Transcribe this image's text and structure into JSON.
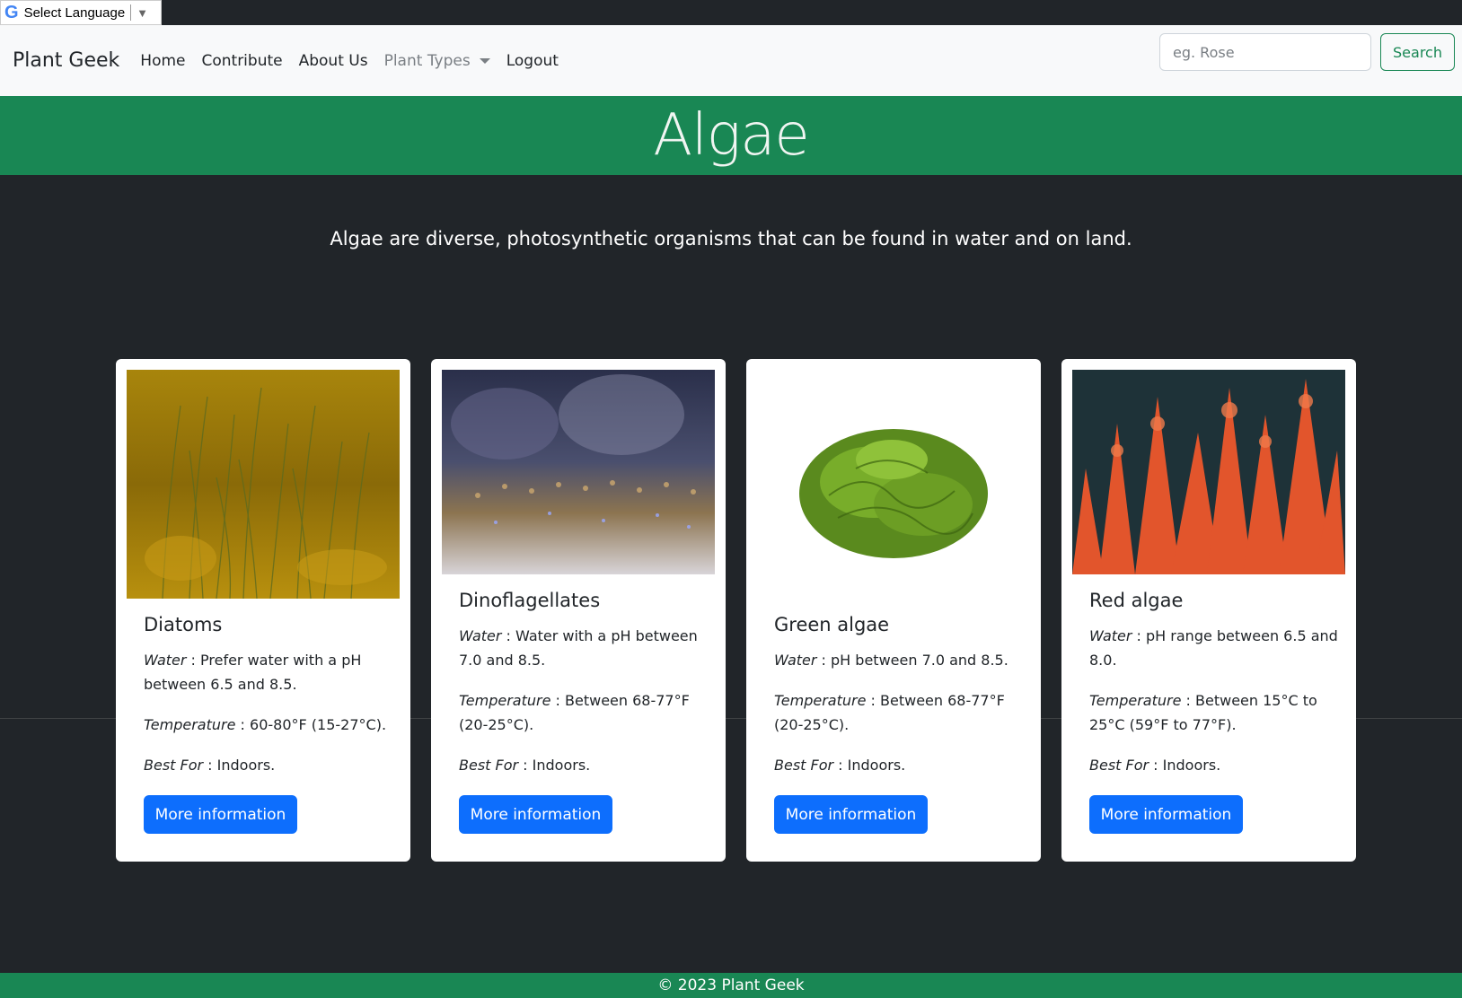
{
  "translate": {
    "label": "Select Language",
    "icon": "google-g-icon",
    "arrow": "▼"
  },
  "navbar": {
    "brand": "Plant Geek",
    "links": [
      "Home",
      "Contribute",
      "About Us"
    ],
    "dropdown": "Plant Types",
    "logout": "Logout",
    "search": {
      "placeholder": "eg. Rose",
      "button": "Search"
    }
  },
  "hero": {
    "title": "Algae"
  },
  "intro": "Algae are diverse, photosynthetic organisms that can be found in water and on land.",
  "labels": {
    "water": "Water",
    "temperature": "Temperature",
    "best_for": "Best For",
    "more": "More information"
  },
  "cards": [
    {
      "title": "Diatoms",
      "water": "Prefer water with a pH between 6.5 and 8.5.",
      "temperature": "60-80°F (15-27°C).",
      "best_for": "Indoors."
    },
    {
      "title": "Dinoflagellates",
      "water": "Water with a pH between 7.0 and 8.5.",
      "temperature": "Between 68-77°F (20-25°C).",
      "best_for": "Indoors."
    },
    {
      "title": "Green algae",
      "water": "pH between 7.0 and 8.5.",
      "temperature": "Between 68-77°F (20-25°C).",
      "best_for": "Indoors."
    },
    {
      "title": "Red algae",
      "water": "pH range between 6.5 and 8.0.",
      "temperature": "Between 15°C to 25°C (59°F to 77°F).",
      "best_for": "Indoors."
    }
  ],
  "footer": "© 2023 Plant Geek",
  "colors": {
    "primary": "#0d6efd",
    "success": "#198754",
    "dark": "#212529",
    "light": "#f8f9fa"
  }
}
